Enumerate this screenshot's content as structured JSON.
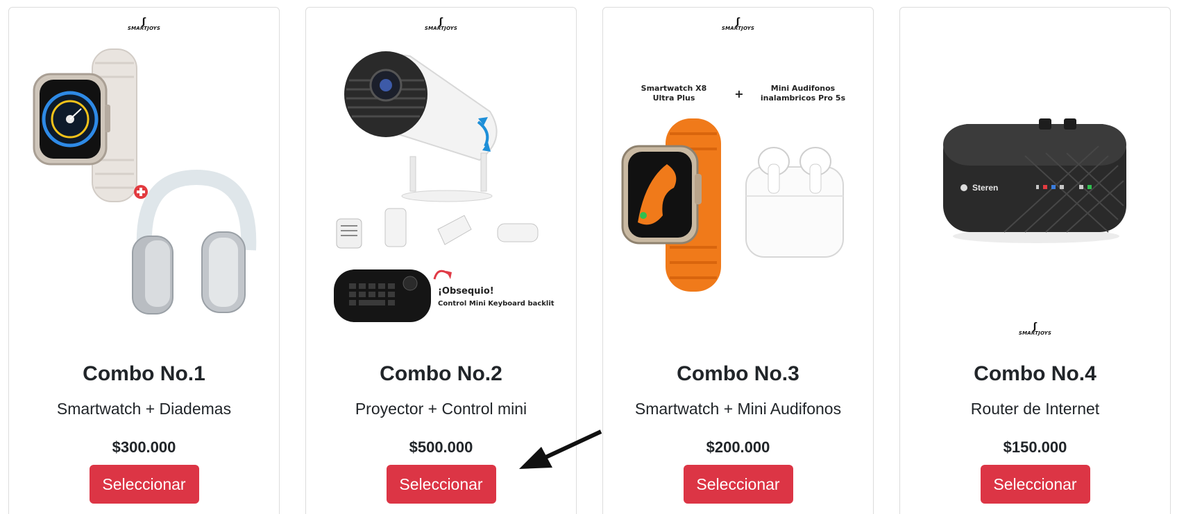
{
  "products": [
    {
      "brand": "SMARTJOYS",
      "title": "Combo No.1",
      "subtitle": "Smartwatch + Diademas",
      "price": "$300.000",
      "button_label": "Seleccionar",
      "image_icons": [
        "smartwatch-icon",
        "headphones-icon",
        "plus-badge-icon"
      ]
    },
    {
      "brand": "SMARTJOYS",
      "title": "Combo No.2",
      "subtitle": "Proyector + Control mini",
      "price": "$500.000",
      "button_label": "Seleccionar",
      "image_icons": [
        "projector-icon",
        "keyboard-icon"
      ],
      "image_texts": {
        "gift_title": "¡Obsequio!",
        "gift_desc": "Control Mini Keyboard backlit"
      }
    },
    {
      "brand": "SMARTJOYS",
      "title": "Combo No.3",
      "subtitle": "Smartwatch + Mini Audifonos",
      "price": "$200.000",
      "button_label": "Seleccionar",
      "image_icons": [
        "smartwatch-icon",
        "earbuds-icon"
      ],
      "image_texts": {
        "left_label_line1": "Smartwatch X8",
        "left_label_line2": "Ultra Plus",
        "plus": "+",
        "right_label_line1": "Mini Audifonos",
        "right_label_line2": "inalambricos Pro 5s"
      }
    },
    {
      "brand": "SMARTJOYS",
      "title": "Combo No.4",
      "subtitle": "Router de Internet",
      "price": "$150.000",
      "button_label": "Seleccionar",
      "image_icons": [
        "router-icon"
      ],
      "image_texts": {
        "router_brand": "Steren"
      }
    }
  ],
  "colors": {
    "button": "#dc3545",
    "card_border": "#dcdcdc",
    "text": "#212529",
    "watch_band_orange": "#f07a1a"
  },
  "annotation": {
    "icon": "arrow-pointer-icon"
  }
}
